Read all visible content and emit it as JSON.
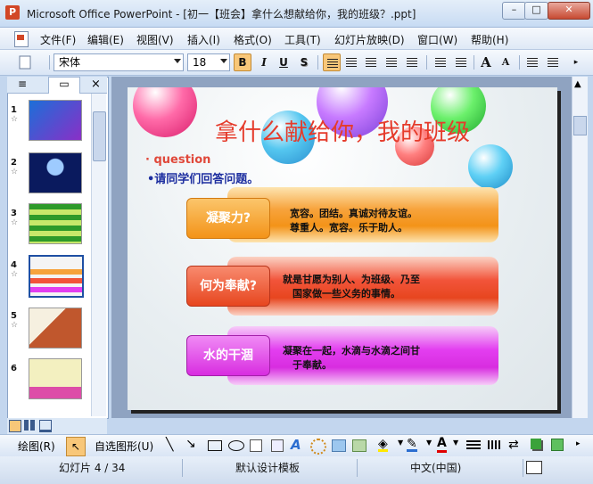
{
  "window": {
    "title": "Microsoft Office PowerPoint - [初一【班会】拿什么想献给你，我的班级？.ppt]",
    "app_icon": "P",
    "minimize": "–",
    "maximize": "□",
    "close": "✕"
  },
  "menu": [
    "文件(F)",
    "编辑(E)",
    "视图(V)",
    "插入(I)",
    "格式(O)",
    "工具(T)",
    "幻灯片放映(D)",
    "窗口(W)",
    "帮助(H)"
  ],
  "toolbar": {
    "font": "宋体",
    "size": "18",
    "bold": "B",
    "italic": "I",
    "underline": "U",
    "shadow": "S",
    "grow": "A",
    "shrink": "A"
  },
  "pane": {
    "outline_tab": "≡",
    "slides_tab": "▭",
    "close": "×",
    "slides": [
      {
        "num": "1",
        "star": "☆",
        "colors": [
          "#1c6fd8",
          "#8a2fc7"
        ]
      },
      {
        "num": "2",
        "star": "☆",
        "colors": [
          "#0a1a5e",
          "#1e3fa8"
        ]
      },
      {
        "num": "3",
        "star": "☆",
        "colors": [
          "#2e9a2a",
          "#c7e86a"
        ]
      },
      {
        "num": "4",
        "star": "☆",
        "colors": [
          "#f4f4f4",
          "#e94a8a"
        ]
      },
      {
        "num": "5",
        "star": "☆",
        "colors": [
          "#f6f0e0",
          "#c0572d"
        ]
      },
      {
        "num": "6",
        "star": "",
        "colors": [
          "#f3f0c0",
          "#dd4da8"
        ]
      }
    ]
  },
  "slide": {
    "title": "拿什么献给你，我的班级",
    "bullet1": "· question",
    "bullet2": "•请同学们回答问题。",
    "rows": [
      {
        "label": "凝聚力?",
        "text": "宽容。团结。真诚对待友谊。\n尊重人。宽容。乐于助人。",
        "accent": "#f39318",
        "band": "#f7a33c"
      },
      {
        "label": "何为奉献?",
        "text": "就是甘愿为别人、为班级、乃至\n　国家做一些义务的事情。",
        "accent": "#e7461f",
        "band": "#f2543a"
      },
      {
        "label": "水的干涸",
        "text": "凝聚在一起，水滴与水滴之间甘\n　于奉献。",
        "accent": "#d82de0",
        "band": "#e33ef0"
      }
    ]
  },
  "drawbar": {
    "draw": "绘图(R)",
    "autoshapes": "自选图形(U)",
    "font_color_letter": "A"
  },
  "status": {
    "slide_info": "幻灯片 4 / 34",
    "template": "默认设计模板",
    "language": "中文(中国)"
  }
}
